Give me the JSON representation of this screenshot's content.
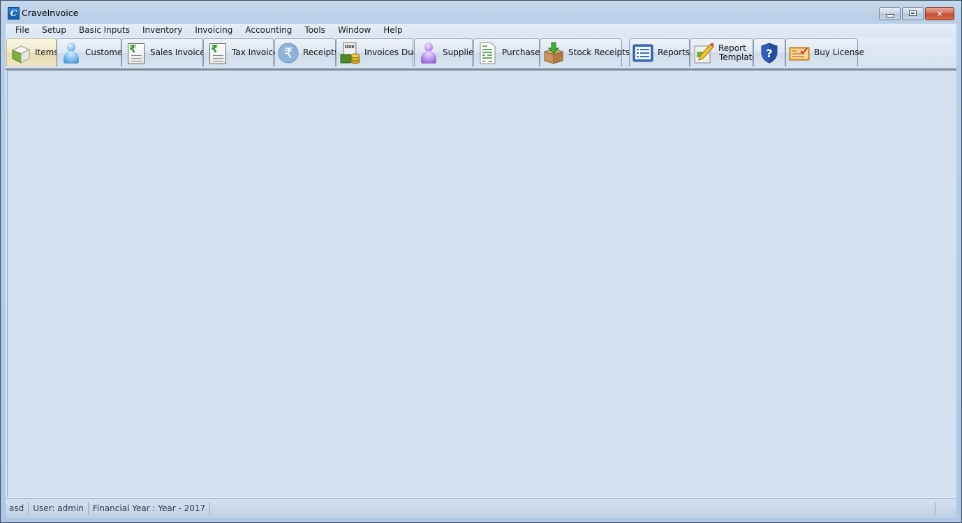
{
  "window": {
    "title": "CraveInvoice",
    "app_icon_letter": "C",
    "controls": [
      "minimize",
      "maximize",
      "close"
    ]
  },
  "menubar": {
    "items": [
      "File",
      "Setup",
      "Basic Inputs",
      "Inventory",
      "Invoicing",
      "Accounting",
      "Tools",
      "Window",
      "Help"
    ]
  },
  "toolbar": {
    "buttons": [
      {
        "label": "Items",
        "icon": "items-box-icon",
        "active": true
      },
      {
        "label": "Customer",
        "icon": "customer-person-icon"
      },
      {
        "label": "Sales Invoices",
        "icon": "sales-invoice-rupee-icon"
      },
      {
        "label": "Tax Invoice",
        "icon": "tax-invoice-rupee-icon"
      },
      {
        "label": "Receipts",
        "icon": "rupee-coin-icon"
      },
      {
        "label": "Invoices Due",
        "icon": "invoices-due-money-icon",
        "icon_text": "DUE"
      },
      {
        "label": "Supplier",
        "icon": "supplier-person-icon"
      },
      {
        "label": "Purchases",
        "icon": "purchases-document-icon"
      },
      {
        "label": "Stock Receipts",
        "icon": "stock-box-arrow-icon"
      },
      {
        "label": "Reports",
        "icon": "reports-list-icon"
      },
      {
        "label_line1": "Report",
        "label_line2": "Template",
        "icon": "report-template-pencil-icon"
      },
      {
        "label": "",
        "icon": "help-shield-icon",
        "icon_text": "?"
      },
      {
        "label": "Buy License",
        "icon": "license-certificate-icon"
      }
    ]
  },
  "statusbar": {
    "company": "asd",
    "user": "User: admin",
    "financial_year": "Financial Year : Year - 2017"
  },
  "colors": {
    "mdi_background": "#d3e0ef",
    "close_button": "#c44a30",
    "active_tab": "#efe6c2"
  }
}
